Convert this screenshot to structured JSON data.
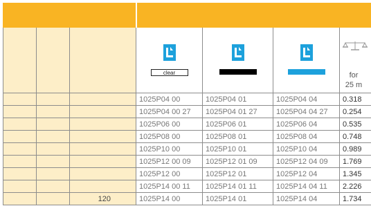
{
  "header": {
    "swatches": {
      "clear_label": "clear",
      "colors": [
        "#ffffff",
        "#000000",
        "#1da1dc"
      ]
    },
    "weight_unit_line1": "for",
    "weight_unit_line2": "25 m",
    "icons": [
      "water-drop-logo-icon",
      "scale-icon"
    ]
  },
  "colors": {
    "banner": "#f9b423",
    "cream": "#fdeec8",
    "logo_blue": "#1da1dc"
  },
  "rows": [
    {
      "c1": "",
      "c2": "",
      "c3": "",
      "clear": "1025P04 00",
      "black": "1025P04 01",
      "blue": "1025P04 04",
      "weight": "0.318"
    },
    {
      "c1": "",
      "c2": "",
      "c3": "",
      "clear": "1025P04 00 27",
      "black": "1025P04 01 27",
      "blue": "1025P04 04 27",
      "weight": "0.254"
    },
    {
      "c1": "",
      "c2": "",
      "c3": "",
      "clear": "1025P06 00",
      "black": "1025P06 01",
      "blue": "1025P06 04",
      "weight": "0.535"
    },
    {
      "c1": "",
      "c2": "",
      "c3": "",
      "clear": "1025P08 00",
      "black": "1025P08 01",
      "blue": "1025P08 04",
      "weight": "0.748"
    },
    {
      "c1": "",
      "c2": "",
      "c3": "",
      "clear": "1025P10 00",
      "black": "1025P10 01",
      "blue": "1025P10 04",
      "weight": "0.989"
    },
    {
      "c1": "",
      "c2": "",
      "c3": "",
      "clear": "1025P12 00 09",
      "black": "1025P12 01 09",
      "blue": "1025P12 04 09",
      "weight": "1.769"
    },
    {
      "c1": "",
      "c2": "",
      "c3": "",
      "clear": "1025P12 00",
      "black": "1025P12 01",
      "blue": "1025P12 04",
      "weight": "1.345"
    },
    {
      "c1": "",
      "c2": "",
      "c3": "",
      "clear": "1025P14 00 11",
      "black": "1025P14 01 11",
      "blue": "1025P14 04 11",
      "weight": "2.226"
    },
    {
      "c1": "",
      "c2": "",
      "c3": "120",
      "clear": "1025P14 00",
      "black": "1025P14 01",
      "blue": "1025P14 04",
      "weight": "1.734"
    }
  ]
}
